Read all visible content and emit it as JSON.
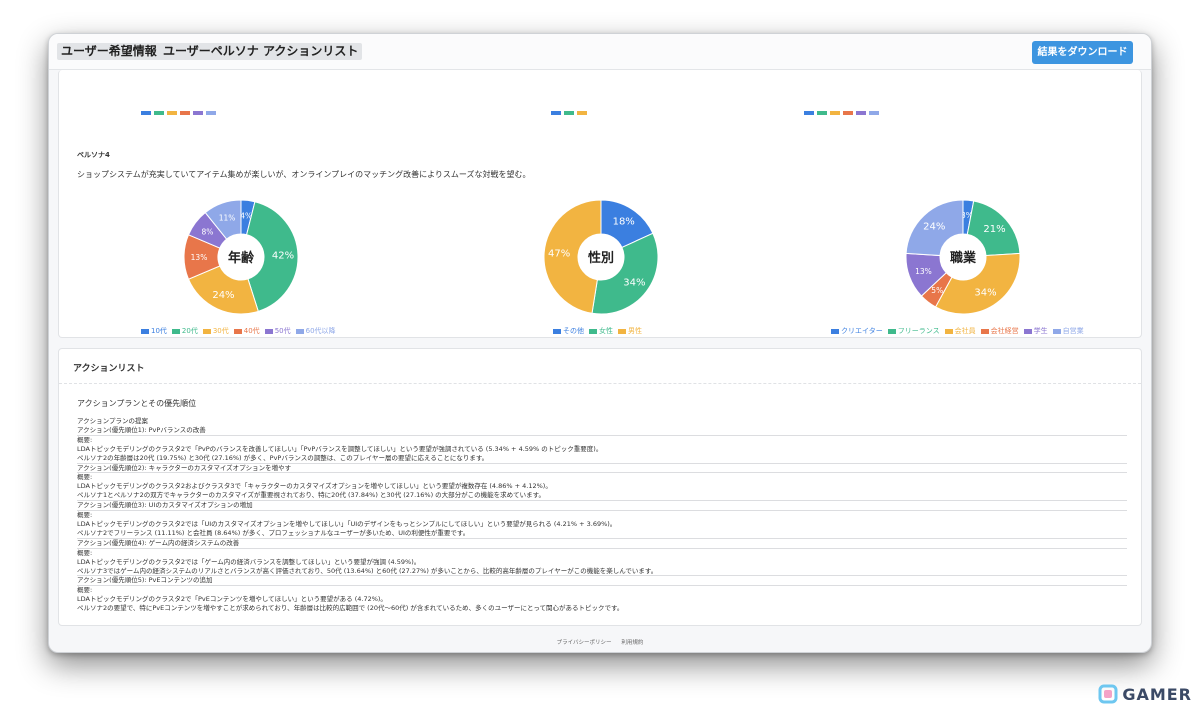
{
  "header": {
    "tabs": [
      {
        "label": "ユーザー希望情報"
      },
      {
        "label": "ユーザーペルソナ"
      },
      {
        "label": "アクションリスト"
      }
    ],
    "download_label": "結果をダウンロード"
  },
  "persona": {
    "title": "ペルソナ4",
    "description": "ショップシステムが充実していてアイテム集めが楽しいが、オンラインプレイのマッチング改善によりスムーズな対戦を望む。",
    "charts": [
      {
        "center_label": "年齢",
        "slices": [
          {
            "label": "10代",
            "value": 4,
            "display": "4%",
            "color": "#3b7fe0"
          },
          {
            "label": "20代",
            "value": 42,
            "display": "42%",
            "color": "#3fba8c"
          },
          {
            "label": "30代",
            "value": 24,
            "display": "24%",
            "color": "#f2b441"
          },
          {
            "label": "40代",
            "value": 13,
            "display": "13%",
            "color": "#e8764a"
          },
          {
            "label": "50代",
            "value": 8,
            "display": "8%",
            "color": "#8b76d1"
          },
          {
            "label": "60代以降",
            "value": 11,
            "display": "11%",
            "color": "#8fa8e8"
          }
        ]
      },
      {
        "center_label": "性別",
        "slices": [
          {
            "label": "その他",
            "value": 18,
            "display": "18%",
            "color": "#3b7fe0"
          },
          {
            "label": "女性",
            "value": 34,
            "display": "34%",
            "color": "#3fba8c"
          },
          {
            "label": "男性",
            "value": 47,
            "display": "47%",
            "color": "#f2b441"
          }
        ]
      },
      {
        "center_label": "職業",
        "slices": [
          {
            "label": "クリエイター",
            "value": 3,
            "display": "3%",
            "color": "#3b7fe0"
          },
          {
            "label": "フリーランス",
            "value": 21,
            "display": "21%",
            "color": "#3fba8c"
          },
          {
            "label": "会社員",
            "value": 34,
            "display": "34%",
            "color": "#f2b441"
          },
          {
            "label": "会社経営",
            "value": 5,
            "display": "5%",
            "color": "#e8764a"
          },
          {
            "label": "学生",
            "value": 13,
            "display": "13%",
            "color": "#8b76d1"
          },
          {
            "label": "自営業",
            "value": 24,
            "display": "24%",
            "color": "#8fa8e8"
          }
        ]
      }
    ]
  },
  "actions": {
    "header": "アクションリスト",
    "subtitle": "アクションプランとその優先順位",
    "lines": [
      {
        "text": "アクションプランの提案",
        "sep": false
      },
      {
        "text": "アクション(優先順位1): PvPバランスの改善",
        "sep": true
      },
      {
        "text": "概要:",
        "sep": false
      },
      {
        "text": "LDAトピックモデリングのクラスタ2で「PvPのバランスを改善してほしい」「PvPバランスを調整してほしい」という要望が強調されている (5.34% + 4.59% のトピック重要度)。",
        "sep": false
      },
      {
        "text": "ペルソナ2の年齢層は20代 (19.75%) と30代 (27.16%) が多く、PvPバランスの調整は、このプレイヤー層の要望に応えることになります。",
        "sep": true
      },
      {
        "text": "アクション(優先順位2): キャラクターのカスタマイズオプションを増やす",
        "sep": true
      },
      {
        "text": "概要:",
        "sep": false
      },
      {
        "text": "LDAトピックモデリングのクラスタ2およびクラスタ3で「キャラクターのカスタマイズオプションを増やしてほしい」という要望が複数存在 (4.86% + 4.12%)。",
        "sep": false
      },
      {
        "text": "ペルソナ1とペルソナ2の双方でキャラクターのカスタマイズが重要視されており、特に20代 (37.84%) と30代 (27.16%) の大部分がこの機能を求めています。",
        "sep": true
      },
      {
        "text": "アクション(優先順位3): UIのカスタマイズオプションの増加",
        "sep": true
      },
      {
        "text": "概要:",
        "sep": false
      },
      {
        "text": "LDAトピックモデリングのクラスタ2では「UIのカスタマイズオプションを増やしてほしい」「UIのデザインをもっとシンプルにしてほしい」という要望が見られる (4.21% + 3.69%)。",
        "sep": false
      },
      {
        "text": "ペルソナ2でフリーランス (11.11%) と会社員 (8.64%) が多く、プロフェッショナルなユーザーが多いため、UIの利便性が重要です。",
        "sep": true
      },
      {
        "text": "アクション(優先順位4): ゲーム内の経済システムの改善",
        "sep": true
      },
      {
        "text": "概要:",
        "sep": false
      },
      {
        "text": "LDAトピックモデリングのクラスタ2では「ゲーム内の経済バランスを調整してほしい」という要望が強調 (4.59%)。",
        "sep": false
      },
      {
        "text": "ペルソナ3ではゲーム内の経済システムのリアルさとバランスが高く評価されており、50代 (13.64%) と60代 (27.27%) が多いことから、比較的高年齢層のプレイヤーがこの機能を楽しんでいます。",
        "sep": true
      },
      {
        "text": "アクション(優先順位5): PvEコンテンツの追加",
        "sep": true
      },
      {
        "text": "概要:",
        "sep": false
      },
      {
        "text": "LDAトピックモデリングのクラスタ2で「PvEコンテンツを増やしてほしい」という要望がある (4.72%)。",
        "sep": false
      },
      {
        "text": "ペルソナ2の要望で、特にPvEコンテンツを増やすことが求められており、年齢層は比較的広範囲で (20代〜60代) が含まれているため、多くのユーザーにとって関心があるトピックです。",
        "sep": false
      }
    ]
  },
  "footer": {
    "privacy": "プライバシーポリシー",
    "terms": "利用規約"
  },
  "brand": {
    "name": "GAMER"
  }
}
